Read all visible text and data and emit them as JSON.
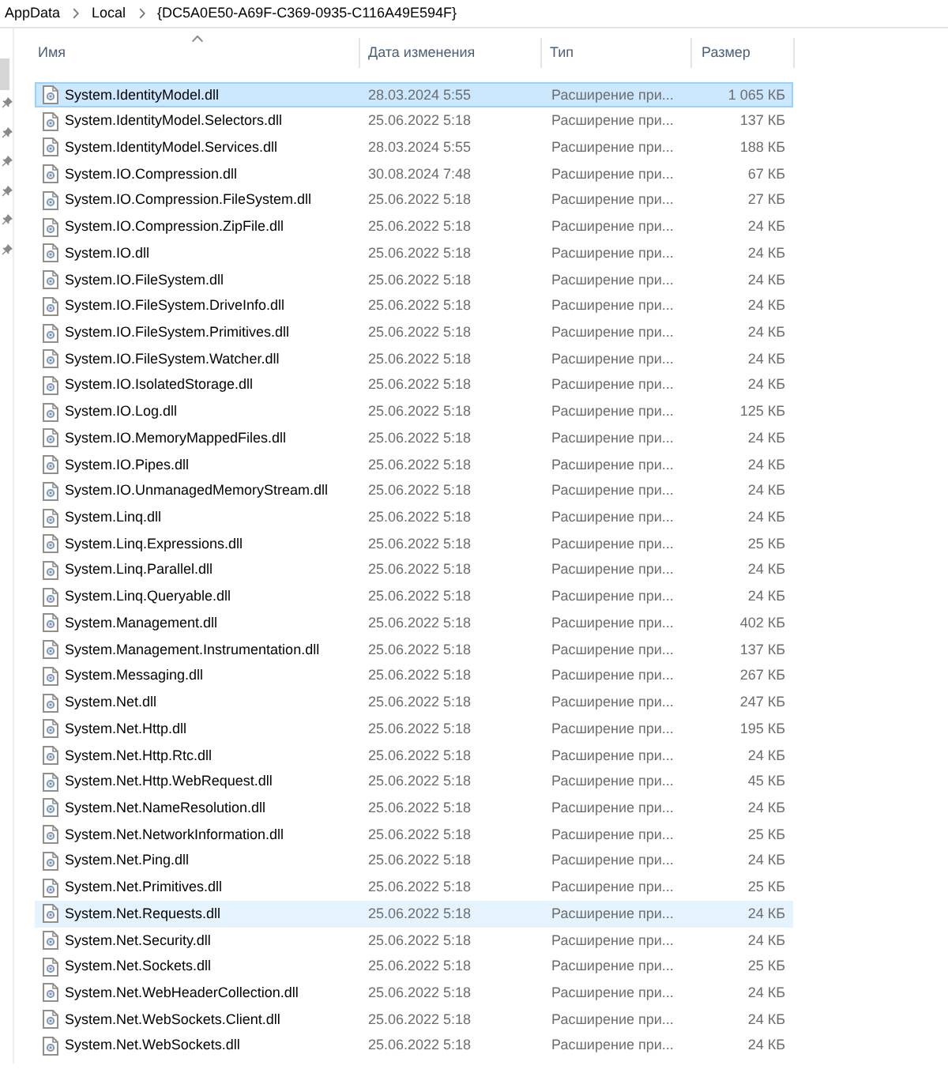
{
  "breadcrumb": {
    "items": [
      "AppData",
      "Local",
      "{DC5A0E50-A69F-C369-0935-C116A49E594F}"
    ]
  },
  "table": {
    "columns": [
      {
        "label": "Имя",
        "sorted": true
      },
      {
        "label": "Дата изменения",
        "sorted": false
      },
      {
        "label": "Тип",
        "sorted": false
      },
      {
        "label": "Размер",
        "sorted": false
      }
    ],
    "rows": [
      {
        "name": "System.IdentityModel.dll",
        "date": "28.03.2024 5:55",
        "type": "Расширение при...",
        "size": "1 065 КБ",
        "selected": true,
        "hovered": false
      },
      {
        "name": "System.IdentityModel.Selectors.dll",
        "date": "25.06.2022 5:18",
        "type": "Расширение при...",
        "size": "137 КБ",
        "selected": false,
        "hovered": false
      },
      {
        "name": "System.IdentityModel.Services.dll",
        "date": "28.03.2024 5:55",
        "type": "Расширение при...",
        "size": "188 КБ",
        "selected": false,
        "hovered": false
      },
      {
        "name": "System.IO.Compression.dll",
        "date": "30.08.2024 7:48",
        "type": "Расширение при...",
        "size": "67 КБ",
        "selected": false,
        "hovered": false
      },
      {
        "name": "System.IO.Compression.FileSystem.dll",
        "date": "25.06.2022 5:18",
        "type": "Расширение при...",
        "size": "27 КБ",
        "selected": false,
        "hovered": false
      },
      {
        "name": "System.IO.Compression.ZipFile.dll",
        "date": "25.06.2022 5:18",
        "type": "Расширение при...",
        "size": "24 КБ",
        "selected": false,
        "hovered": false
      },
      {
        "name": "System.IO.dll",
        "date": "25.06.2022 5:18",
        "type": "Расширение при...",
        "size": "24 КБ",
        "selected": false,
        "hovered": false
      },
      {
        "name": "System.IO.FileSystem.dll",
        "date": "25.06.2022 5:18",
        "type": "Расширение при...",
        "size": "24 КБ",
        "selected": false,
        "hovered": false
      },
      {
        "name": "System.IO.FileSystem.DriveInfo.dll",
        "date": "25.06.2022 5:18",
        "type": "Расширение при...",
        "size": "24 КБ",
        "selected": false,
        "hovered": false
      },
      {
        "name": "System.IO.FileSystem.Primitives.dll",
        "date": "25.06.2022 5:18",
        "type": "Расширение при...",
        "size": "24 КБ",
        "selected": false,
        "hovered": false
      },
      {
        "name": "System.IO.FileSystem.Watcher.dll",
        "date": "25.06.2022 5:18",
        "type": "Расширение при...",
        "size": "24 КБ",
        "selected": false,
        "hovered": false
      },
      {
        "name": "System.IO.IsolatedStorage.dll",
        "date": "25.06.2022 5:18",
        "type": "Расширение при...",
        "size": "24 КБ",
        "selected": false,
        "hovered": false
      },
      {
        "name": "System.IO.Log.dll",
        "date": "25.06.2022 5:18",
        "type": "Расширение при...",
        "size": "125 КБ",
        "selected": false,
        "hovered": false
      },
      {
        "name": "System.IO.MemoryMappedFiles.dll",
        "date": "25.06.2022 5:18",
        "type": "Расширение при...",
        "size": "24 КБ",
        "selected": false,
        "hovered": false
      },
      {
        "name": "System.IO.Pipes.dll",
        "date": "25.06.2022 5:18",
        "type": "Расширение при...",
        "size": "24 КБ",
        "selected": false,
        "hovered": false
      },
      {
        "name": "System.IO.UnmanagedMemoryStream.dll",
        "date": "25.06.2022 5:18",
        "type": "Расширение при...",
        "size": "24 КБ",
        "selected": false,
        "hovered": false
      },
      {
        "name": "System.Linq.dll",
        "date": "25.06.2022 5:18",
        "type": "Расширение при...",
        "size": "24 КБ",
        "selected": false,
        "hovered": false
      },
      {
        "name": "System.Linq.Expressions.dll",
        "date": "25.06.2022 5:18",
        "type": "Расширение при...",
        "size": "25 КБ",
        "selected": false,
        "hovered": false
      },
      {
        "name": "System.Linq.Parallel.dll",
        "date": "25.06.2022 5:18",
        "type": "Расширение при...",
        "size": "24 КБ",
        "selected": false,
        "hovered": false
      },
      {
        "name": "System.Linq.Queryable.dll",
        "date": "25.06.2022 5:18",
        "type": "Расширение при...",
        "size": "24 КБ",
        "selected": false,
        "hovered": false
      },
      {
        "name": "System.Management.dll",
        "date": "25.06.2022 5:18",
        "type": "Расширение при...",
        "size": "402 КБ",
        "selected": false,
        "hovered": false
      },
      {
        "name": "System.Management.Instrumentation.dll",
        "date": "25.06.2022 5:18",
        "type": "Расширение при...",
        "size": "137 КБ",
        "selected": false,
        "hovered": false
      },
      {
        "name": "System.Messaging.dll",
        "date": "25.06.2022 5:18",
        "type": "Расширение при...",
        "size": "267 КБ",
        "selected": false,
        "hovered": false
      },
      {
        "name": "System.Net.dll",
        "date": "25.06.2022 5:18",
        "type": "Расширение при...",
        "size": "247 КБ",
        "selected": false,
        "hovered": false
      },
      {
        "name": "System.Net.Http.dll",
        "date": "25.06.2022 5:18",
        "type": "Расширение при...",
        "size": "195 КБ",
        "selected": false,
        "hovered": false
      },
      {
        "name": "System.Net.Http.Rtc.dll",
        "date": "25.06.2022 5:18",
        "type": "Расширение при...",
        "size": "24 КБ",
        "selected": false,
        "hovered": false
      },
      {
        "name": "System.Net.Http.WebRequest.dll",
        "date": "25.06.2022 5:18",
        "type": "Расширение при...",
        "size": "45 КБ",
        "selected": false,
        "hovered": false
      },
      {
        "name": "System.Net.NameResolution.dll",
        "date": "25.06.2022 5:18",
        "type": "Расширение при...",
        "size": "24 КБ",
        "selected": false,
        "hovered": false
      },
      {
        "name": "System.Net.NetworkInformation.dll",
        "date": "25.06.2022 5:18",
        "type": "Расширение при...",
        "size": "25 КБ",
        "selected": false,
        "hovered": false
      },
      {
        "name": "System.Net.Ping.dll",
        "date": "25.06.2022 5:18",
        "type": "Расширение при...",
        "size": "24 КБ",
        "selected": false,
        "hovered": false
      },
      {
        "name": "System.Net.Primitives.dll",
        "date": "25.06.2022 5:18",
        "type": "Расширение при...",
        "size": "25 КБ",
        "selected": false,
        "hovered": false
      },
      {
        "name": "System.Net.Requests.dll",
        "date": "25.06.2022 5:18",
        "type": "Расширение при...",
        "size": "24 КБ",
        "selected": false,
        "hovered": true
      },
      {
        "name": "System.Net.Security.dll",
        "date": "25.06.2022 5:18",
        "type": "Расширение при...",
        "size": "24 КБ",
        "selected": false,
        "hovered": false
      },
      {
        "name": "System.Net.Sockets.dll",
        "date": "25.06.2022 5:18",
        "type": "Расширение при...",
        "size": "25 КБ",
        "selected": false,
        "hovered": false
      },
      {
        "name": "System.Net.WebHeaderCollection.dll",
        "date": "25.06.2022 5:18",
        "type": "Расширение при...",
        "size": "24 КБ",
        "selected": false,
        "hovered": false
      },
      {
        "name": "System.Net.WebSockets.Client.dll",
        "date": "25.06.2022 5:18",
        "type": "Расширение при...",
        "size": "24 КБ",
        "selected": false,
        "hovered": false
      },
      {
        "name": "System.Net.WebSockets.dll",
        "date": "25.06.2022 5:18",
        "type": "Расширение при...",
        "size": "24 КБ",
        "selected": false,
        "hovered": false
      }
    ]
  }
}
